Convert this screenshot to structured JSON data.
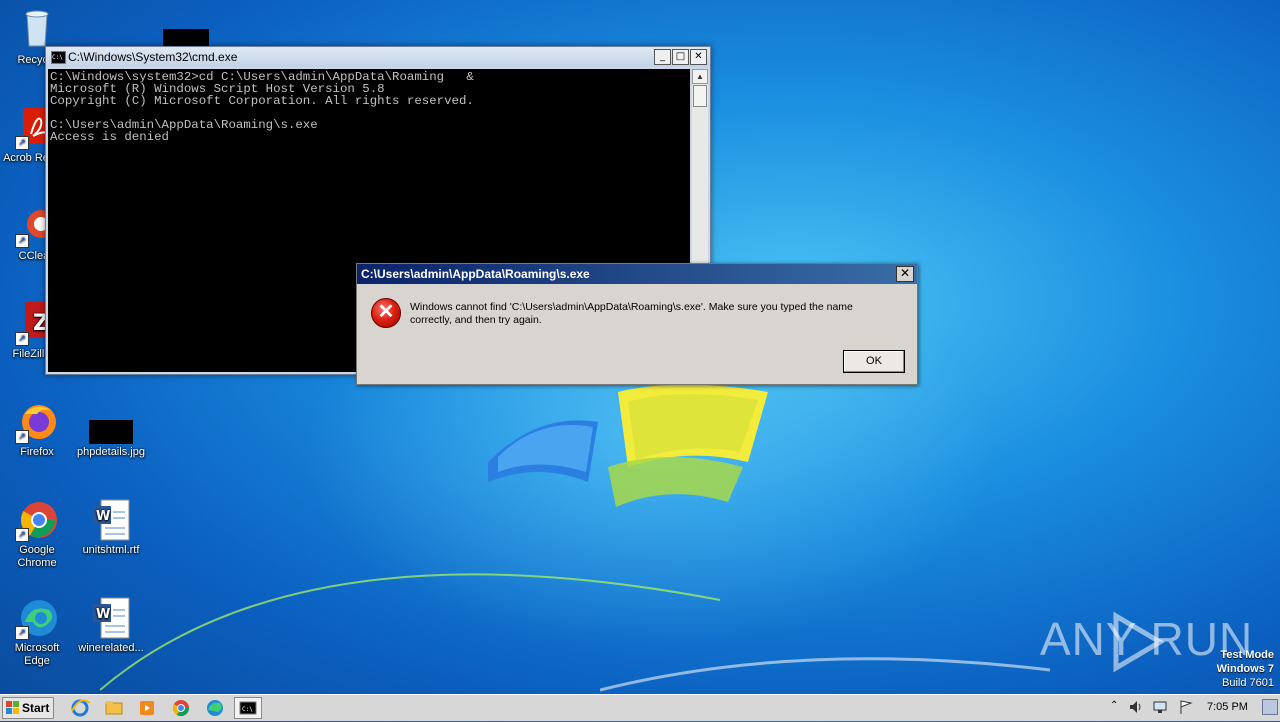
{
  "desktop": {
    "icons": [
      {
        "label": "Recycle",
        "name": "recycle-bin"
      },
      {
        "label": "Acrob Reader",
        "name": "acrobat-reader"
      },
      {
        "label": "CClean",
        "name": "ccleaner"
      },
      {
        "label": "FileZilla C",
        "name": "filezilla"
      },
      {
        "label": "Firefox",
        "name": "firefox"
      },
      {
        "label": "phpdetails.jpg",
        "name": "phpdetails-jpg"
      },
      {
        "label": "Google Chrome",
        "name": "google-chrome"
      },
      {
        "label": "unitshtml.rtf",
        "name": "unitshtml-rtf"
      },
      {
        "label": "Microsoft Edge",
        "name": "microsoft-edge"
      },
      {
        "label": "winerelated...",
        "name": "winerelated"
      }
    ]
  },
  "cmd": {
    "title": "C:\\Windows\\System32\\cmd.exe",
    "icon_text": "C:\\",
    "minimize": "_",
    "maximize": "□",
    "close": "✕",
    "output": "C:\\Windows\\system32>cd C:\\Users\\admin\\AppData\\Roaming   &\nMicrosoft (R) Windows Script Host Version 5.8\nCopyright (C) Microsoft Corporation. All rights reserved.\n\nC:\\Users\\admin\\AppData\\Roaming\\s.exe\nAccess is denied"
  },
  "dialog": {
    "title": "C:\\Users\\admin\\AppData\\Roaming\\s.exe",
    "message": "Windows cannot find 'C:\\Users\\admin\\AppData\\Roaming\\s.exe'. Make sure you typed the name correctly, and then try again.",
    "ok_label": "OK",
    "close": "✕",
    "error_glyph": "✕"
  },
  "watermark": {
    "text": "ANY RUN"
  },
  "test_mode": {
    "line1": "Test Mode",
    "line2": "Windows 7",
    "line3": "Build 7601"
  },
  "taskbar": {
    "start_label": "Start",
    "clock": "7:05 PM",
    "pinned": [
      "internet-explorer-icon",
      "explorer-icon",
      "media-player-icon",
      "chrome-icon",
      "edge-icon",
      "cmd-icon"
    ]
  }
}
